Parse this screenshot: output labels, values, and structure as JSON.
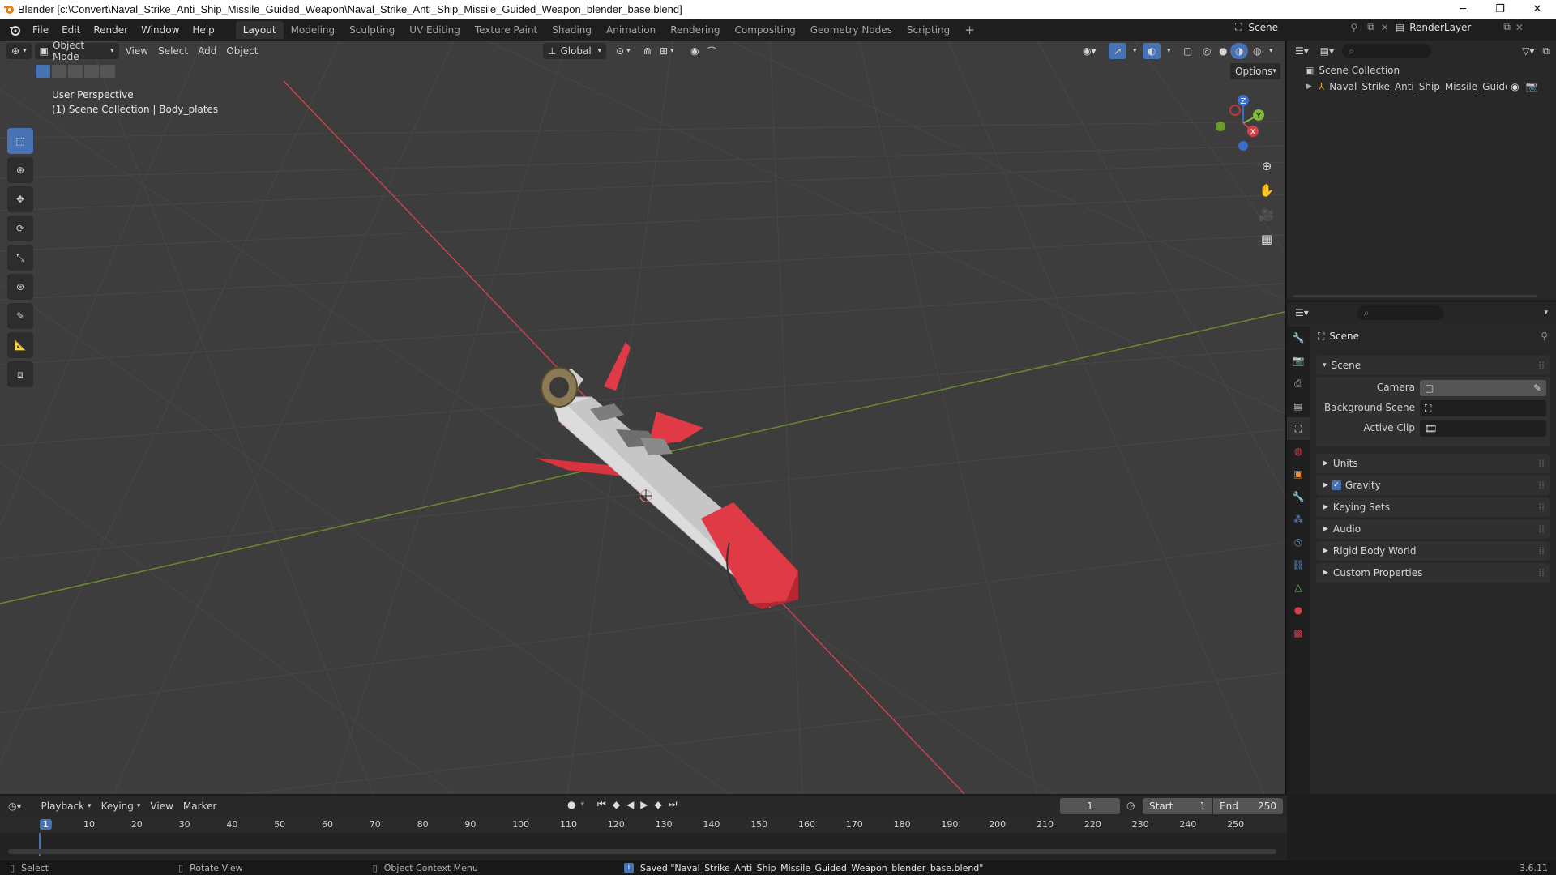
{
  "window": {
    "title": "Blender [c:\\Convert\\Naval_Strike_Anti_Ship_Missile_Guided_Weapon\\Naval_Strike_Anti_Ship_Missile_Guided_Weapon_blender_base.blend]"
  },
  "menu": [
    "File",
    "Edit",
    "Render",
    "Window",
    "Help"
  ],
  "workspaces": [
    "Layout",
    "Modeling",
    "Sculpting",
    "UV Editing",
    "Texture Paint",
    "Shading",
    "Animation",
    "Rendering",
    "Compositing",
    "Geometry Nodes",
    "Scripting"
  ],
  "active_workspace": "Layout",
  "scene_selector": {
    "label": "Scene",
    "render_layer": "RenderLayer"
  },
  "viewport": {
    "mode": "Object Mode",
    "header_menus": [
      "View",
      "Select",
      "Add",
      "Object"
    ],
    "orientation": "Global",
    "options_label": "Options",
    "overlay_line1": "User Perspective",
    "overlay_line2": "(1) Scene Collection | Body_plates",
    "gizmo_axes": {
      "x": "X",
      "y": "Y",
      "z": "Z"
    }
  },
  "outliner": {
    "root": "Scene Collection",
    "items": [
      {
        "label": "Naval_Strike_Anti_Ship_Missile_Guided_"
      }
    ]
  },
  "properties": {
    "header": "Scene",
    "section": "Scene",
    "fields": [
      {
        "label": "Camera",
        "value": ""
      },
      {
        "label": "Background Scene",
        "value": ""
      },
      {
        "label": "Active Clip",
        "value": ""
      }
    ],
    "panels": [
      "Units",
      "Gravity",
      "Keying Sets",
      "Audio",
      "Rigid Body World",
      "Custom Properties"
    ],
    "gravity_checked": true
  },
  "timeline": {
    "menus": [
      "Playback",
      "Keying",
      "View",
      "Marker"
    ],
    "current_frame": "1",
    "start_label": "Start",
    "start_value": "1",
    "end_label": "End",
    "end_value": "250",
    "ruler": [
      "1",
      "10",
      "20",
      "30",
      "40",
      "50",
      "60",
      "70",
      "80",
      "90",
      "100",
      "110",
      "120",
      "130",
      "140",
      "150",
      "160",
      "170",
      "180",
      "190",
      "200",
      "210",
      "220",
      "230",
      "240",
      "250"
    ]
  },
  "status": {
    "select": "Select",
    "rotate": "Rotate View",
    "context_menu": "Object Context Menu",
    "message": "Saved \"Naval_Strike_Anti_Ship_Missile_Guided_Weapon_blender_base.blend\"",
    "version": "3.6.11"
  },
  "colors": {
    "accent": "#4772b3",
    "missile_red": "#e03a46",
    "missile_body": "#d8d8d8",
    "x_axis": "#d23b44",
    "y_axis": "#6f9a2a"
  }
}
